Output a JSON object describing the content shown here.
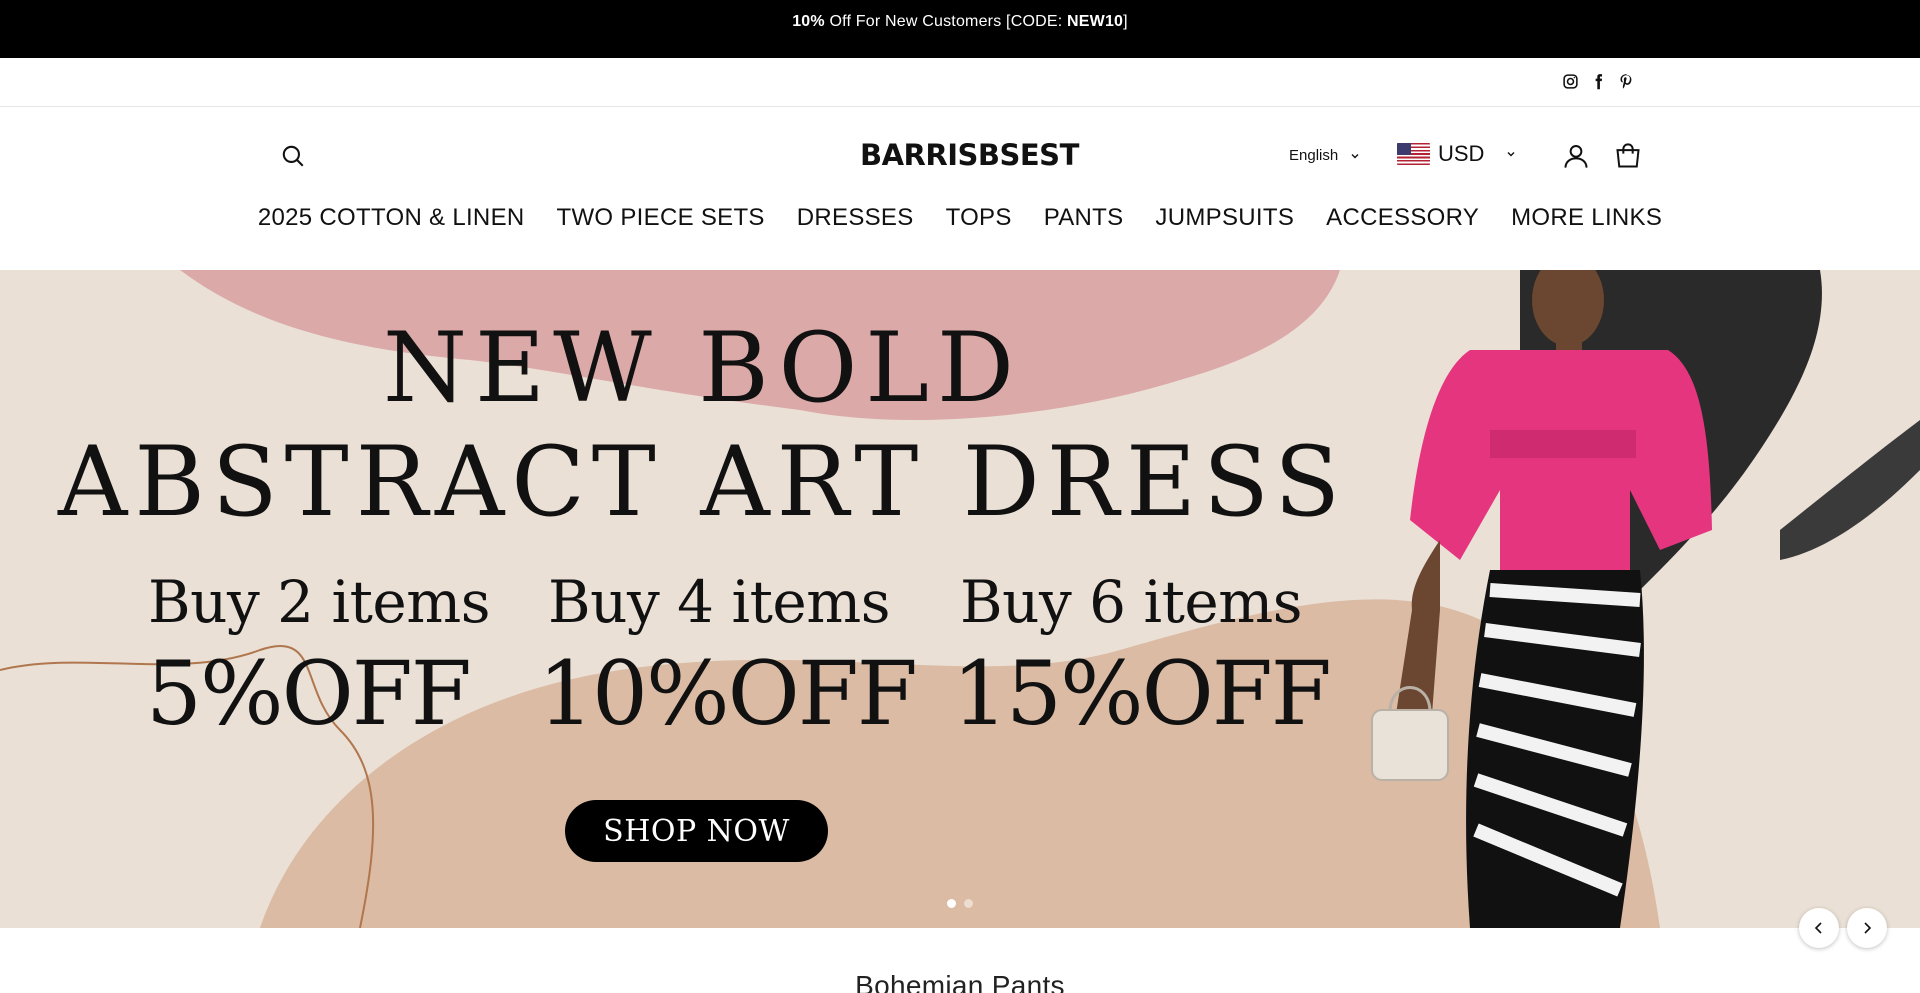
{
  "announcement": {
    "prefix": "",
    "discount": "10%",
    "middle": " Off For New Customers [CODE: ",
    "code": "NEW10",
    "suffix": "]"
  },
  "social": {
    "icons": [
      "instagram-icon",
      "facebook-icon",
      "pinterest-icon"
    ]
  },
  "header": {
    "logo": "BARRISBSEST",
    "language": "English",
    "currency": "USD"
  },
  "nav": {
    "items": [
      {
        "label": "2025 COTTON & LINEN"
      },
      {
        "label": "TWO PIECE SETS"
      },
      {
        "label": "DRESSES"
      },
      {
        "label": "TOPS"
      },
      {
        "label": "PANTS"
      },
      {
        "label": "JUMPSUITS"
      },
      {
        "label": "ACCESSORY"
      },
      {
        "label": "MORE LINKS"
      }
    ]
  },
  "hero": {
    "title_line1": "NEW BOLD",
    "title_line2": "ABSTRACT ART DRESS",
    "offers": [
      {
        "buy": "Buy 2 items",
        "off": "5%OFF"
      },
      {
        "buy": "Buy 4 items",
        "off": "10%OFF"
      },
      {
        "buy": "Buy 6 items",
        "off": "15%OFF"
      }
    ],
    "cta": "SHOP NOW",
    "slide_count": 2,
    "active_slide": 1
  },
  "colors": {
    "announcement_bg": "#000000",
    "hero_bg": "#e8dcd0",
    "dress_pink": "#e5357f",
    "cta_bg": "#000000"
  },
  "section": {
    "title": "Bohemian Pants"
  }
}
